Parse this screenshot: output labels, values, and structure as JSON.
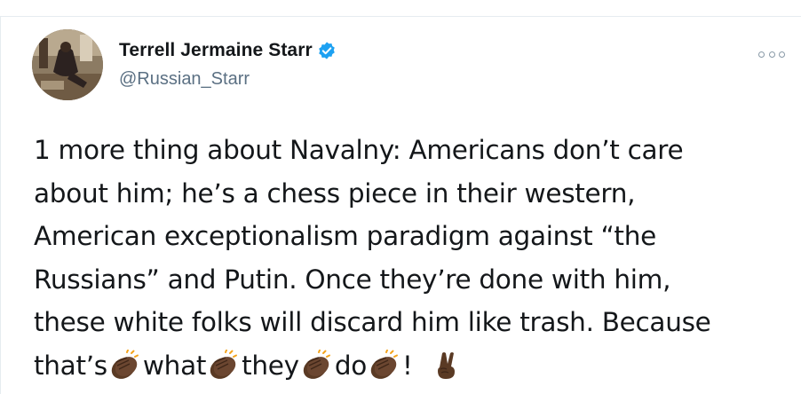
{
  "tweet": {
    "author": {
      "display_name": "Terrell Jermaine Starr",
      "handle": "@Russian_Starr",
      "verified": true
    },
    "more_icon": "more-options-icon",
    "text_lines": [
      "1 more thing about Navalny: Americans don’t care",
      "about him; he’s a chess piece in their western,",
      "American exceptionalism paradigm against “the",
      "Russians” and Putin. Once they’re done with him,",
      "these white folks will discard him like trash. Because"
    ],
    "last_line": {
      "w1": "that’s",
      "w2": "what",
      "w3": "they",
      "w4": "do",
      "w5": "!"
    },
    "emojis": [
      "clapping-hands-icon",
      "victory-hand-icon"
    ],
    "colors": {
      "verified": "#1da1f2",
      "handle": "#5b7083",
      "text": "#14171a",
      "skin": "#5a3a24"
    }
  }
}
